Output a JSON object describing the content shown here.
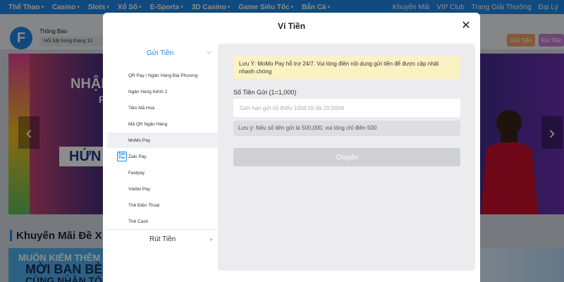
{
  "topnav": {
    "items": [
      "Thể Thao",
      "Casino",
      "Slots",
      "Xổ Số",
      "E-Sports",
      "3D Casino",
      "Game Siêu Tốc",
      "Bắn Cá"
    ],
    "right_links": [
      "Khuyến Mãi",
      "VIP Club",
      "Trang Giải Thưởng",
      "Đại Lý"
    ]
  },
  "header": {
    "logo": "F",
    "notice_label": "Thông Báo",
    "notice_text": "Nổi bật trong tháng 10",
    "deposit_label": "Gửi Tiền",
    "withdraw_label": "Rút Tiền"
  },
  "banner": {
    "line1": "NHẬN",
    "line2": "HỨN",
    "line3": "F"
  },
  "section": {
    "title": "Khuyến Mãi Đề X"
  },
  "promo": {
    "line1": "MUỐN KIẾM THÊM",
    "line2": "MỜI BẠN BÈ",
    "line3": "CÙNG NHẬN TỐI ĐA"
  },
  "modal": {
    "title": "Ví Tiền",
    "menu": {
      "deposit_header": "Gửi Tiền",
      "items": [
        "QR Pay / Ngân Hàng Địa Phương",
        "Ngân Hàng Kênh 2",
        "Tiền Mã Hoá",
        "Mã QR Ngân Hàng",
        "MoMo Pay",
        "Zalo Pay",
        "Fastpay",
        "Viettel Pay",
        "Thẻ Điện Thoại",
        "Thẻ Cash"
      ],
      "active_index": 4,
      "zalo_badge": "Zalo Pay",
      "withdraw": "Rút Tiền"
    },
    "form": {
      "note": "Lưu Ý: MoMo Pay hỗ trợ 24/7. Vui lòng điền nội dung gửi tiền để được cập nhật nhanh chóng",
      "amount_label": "Số Tiền Gửi (1=1,000)",
      "amount_value": "",
      "amount_placeholder": "Giới hạn gửi tối thiểu 100đ tối đa 20,000đ",
      "hint": "Lưu ý: Nếu số tiền gửi là 500,000, vui lòng chỉ điền 500",
      "submit_label": "Chuyển"
    }
  },
  "colors": {
    "accent": "#1e88e5",
    "note_bg": "#fbf2c4",
    "deposit_pill": "#f0a36b",
    "withdraw_pill": "#c980d8"
  }
}
